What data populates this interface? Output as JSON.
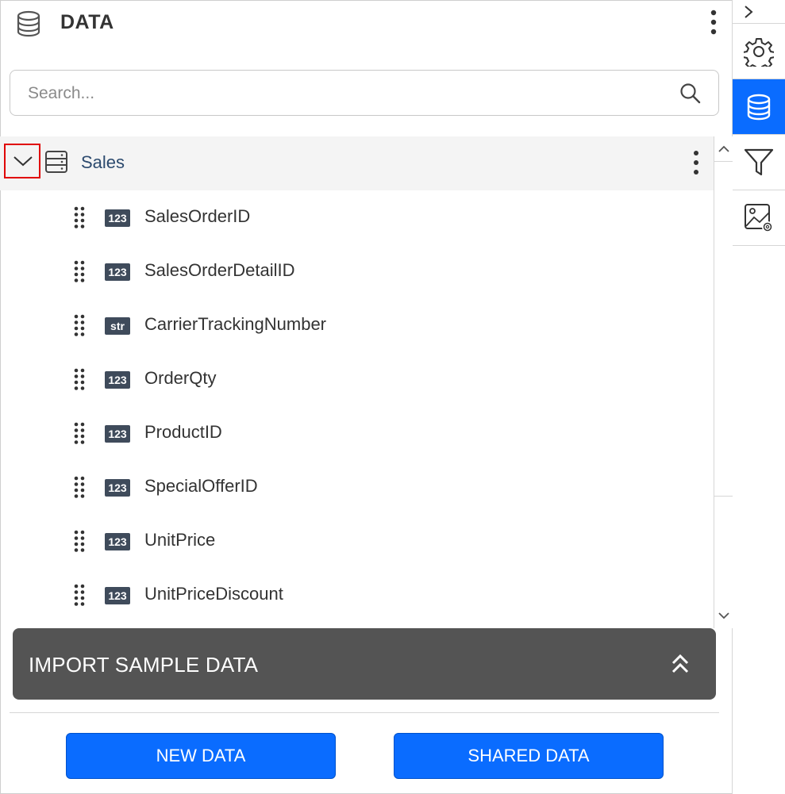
{
  "header": {
    "title": "DATA",
    "icon": "database-icon"
  },
  "search": {
    "placeholder": "Search..."
  },
  "tree": {
    "group": {
      "label": "Sales",
      "icon": "table-icon",
      "expanded": true
    },
    "fields": [
      {
        "type_badge": "123",
        "label": "SalesOrderID"
      },
      {
        "type_badge": "123",
        "label": "SalesOrderDetailID"
      },
      {
        "type_badge": "str",
        "label": "CarrierTrackingNumber"
      },
      {
        "type_badge": "123",
        "label": "OrderQty"
      },
      {
        "type_badge": "123",
        "label": "ProductID"
      },
      {
        "type_badge": "123",
        "label": "SpecialOfferID"
      },
      {
        "type_badge": "123",
        "label": "UnitPrice"
      },
      {
        "type_badge": "123",
        "label": "UnitPriceDiscount"
      }
    ]
  },
  "import": {
    "label": "IMPORT SAMPLE DATA"
  },
  "buttons": {
    "new_data": "NEW DATA",
    "shared_data": "SHARED DATA"
  },
  "rail": {
    "items": [
      "chevron-right-icon",
      "gear-icon",
      "database-icon",
      "filter-icon",
      "image-settings-icon"
    ],
    "active": "database-icon"
  },
  "colors": {
    "accent": "#0a6cff",
    "import_bar": "#545454",
    "badge": "#3f4b5b",
    "highlight": "#e00000"
  }
}
